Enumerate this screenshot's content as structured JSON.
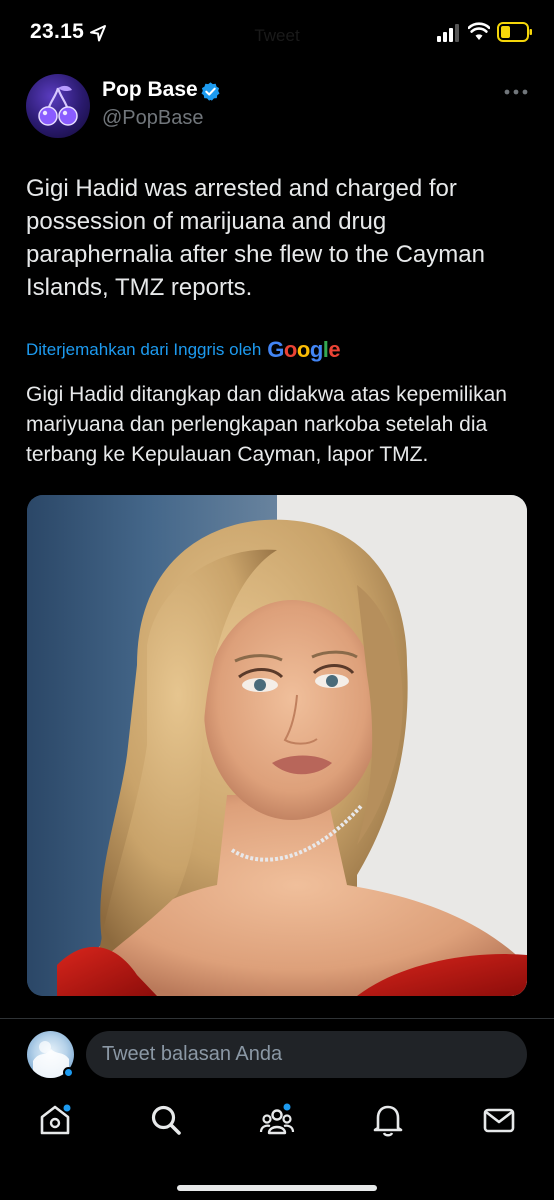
{
  "status_bar": {
    "time": "23.15",
    "title": "Tweet"
  },
  "author": {
    "name": "Pop Base",
    "handle": "@PopBase",
    "verified": true
  },
  "tweet": {
    "text": "Gigi Hadid was arrested and charged for possession of marijuana and drug paraphernalia after she flew to the Cayman Islands, TMZ reports.",
    "translation_label": "Diterjemahkan dari Inggris oleh",
    "translation_provider": "Google",
    "translated_text": "Gigi Hadid ditangkap dan didakwa atas kepemilikan mariyuana dan perlengkapan narkoba setelah dia terbang ke Kepulauan Cayman, lapor TMZ."
  },
  "reply": {
    "placeholder": "Tweet balasan Anda"
  },
  "tab_bar": {
    "items": [
      "home-icon",
      "search-icon",
      "communities-icon",
      "notifications-icon",
      "messages-icon"
    ]
  },
  "colors": {
    "accent": "#1d9bf0",
    "background": "#000000",
    "text": "#e7e9ea",
    "secondary_text": "#71767b",
    "battery": "#f5d60a"
  }
}
